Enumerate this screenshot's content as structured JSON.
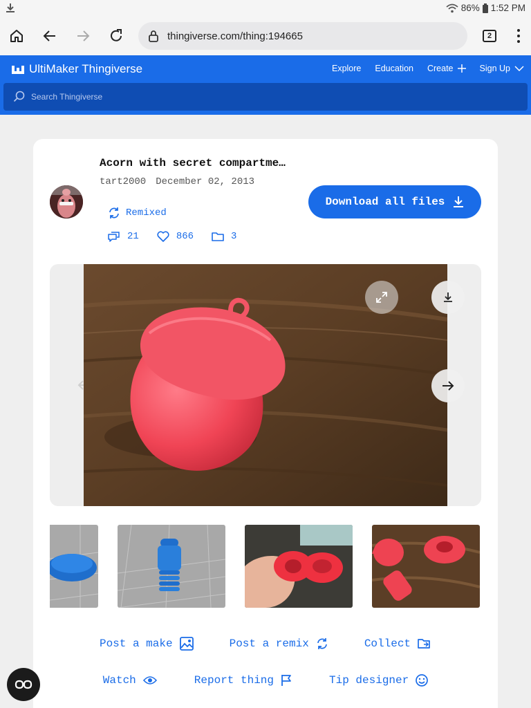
{
  "status_bar": {
    "battery": "86%",
    "time": "1:52 PM"
  },
  "browser": {
    "url": "thingiverse.com/thing:194665",
    "tab_count": "2"
  },
  "site": {
    "brand": "UltiMaker Thingiverse",
    "nav": {
      "explore": "Explore",
      "education": "Education",
      "create": "Create",
      "signup": "Sign Up"
    },
    "search_placeholder": "Search Thingiverse",
    "accent_color": "#1a6ce8"
  },
  "thing": {
    "title": "Acorn with secret compartme…",
    "author": "tart2000",
    "date": "December 02, 2013",
    "remixed_label": "Remixed",
    "comments": "21",
    "likes": "866",
    "collections": "3",
    "download_label": "Download all files"
  },
  "actions": {
    "post_make": "Post a make",
    "post_remix": "Post a remix",
    "collect": "Collect",
    "watch": "Watch",
    "report": "Report thing",
    "tip": "Tip designer"
  }
}
